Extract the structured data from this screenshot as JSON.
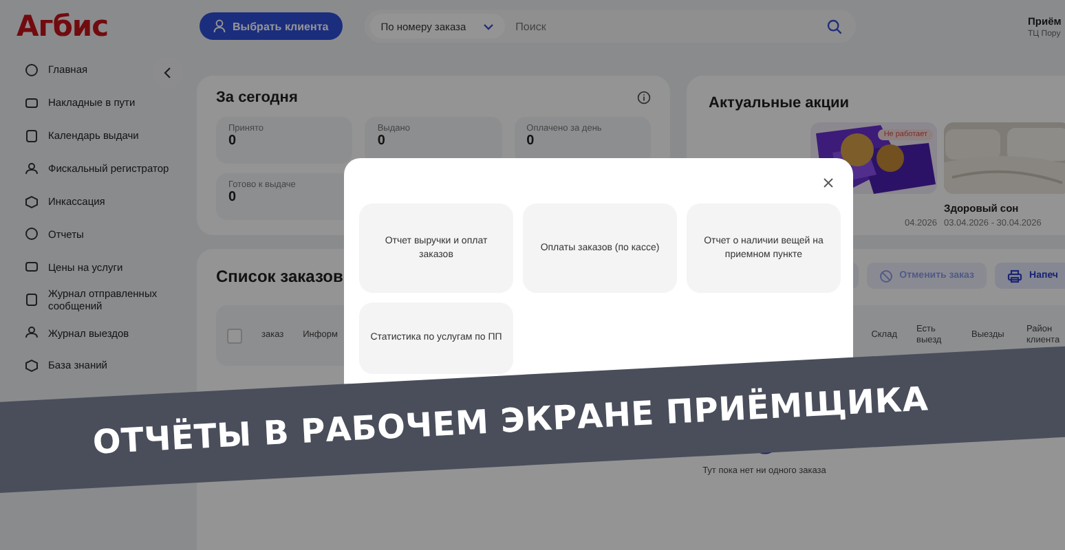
{
  "logo": "Агбис",
  "header": {
    "client_button": "Выбрать клиента",
    "search_mode": "По номеру заказа",
    "search": {
      "placeholder": "Поиск"
    },
    "user": {
      "name": "Приём",
      "location": "ТЦ Пору"
    }
  },
  "sidebar": {
    "items": [
      {
        "label": "Главная"
      },
      {
        "label": "Накладные в пути"
      },
      {
        "label": "Календарь выдачи"
      },
      {
        "label": "Фискальный регистратор"
      },
      {
        "label": "Инкассация"
      },
      {
        "label": "Отчеты"
      },
      {
        "label": "Цены на услуги"
      },
      {
        "label": "Журнал отправленных сообщений"
      },
      {
        "label": "Журнал выездов"
      },
      {
        "label": "База знаний"
      }
    ]
  },
  "today": {
    "title": "За сегодня",
    "stats": [
      {
        "label": "Принято",
        "value": "0"
      },
      {
        "label": "Выдано",
        "value": "0"
      },
      {
        "label": "Оплачено за день",
        "value": "0"
      },
      {
        "label": "Готово к выдаче",
        "value": "0"
      }
    ]
  },
  "promos": {
    "title": "Актуальные акции",
    "items": [
      {
        "badge": "Не работает",
        "date": "04.2026"
      },
      {
        "name": "Здоровый сон",
        "date": "03.04.2026 - 30.04.2026"
      }
    ]
  },
  "orders": {
    "title": "Список заказов",
    "select_all_checked": false,
    "actions": [
      "Отменить заказ",
      "Напеч"
    ],
    "columns": [
      "заказ",
      "Информ",
      "Склад",
      "Есть выезд",
      "Выезды",
      "Район клиента"
    ],
    "empty": "Тут пока нет ни одного заказа"
  },
  "modal": {
    "reports": [
      "Отчет выручки и оплат заказов",
      "Оплаты заказов (по кассе)",
      "Отчет о наличии вещей на приемном пункте",
      "Статистика по услугам по ПП"
    ]
  },
  "banner": "ОТЧЁТЫ В РАБОЧЕМ ЭКРАНЕ ПРИЁМЩИКА"
}
